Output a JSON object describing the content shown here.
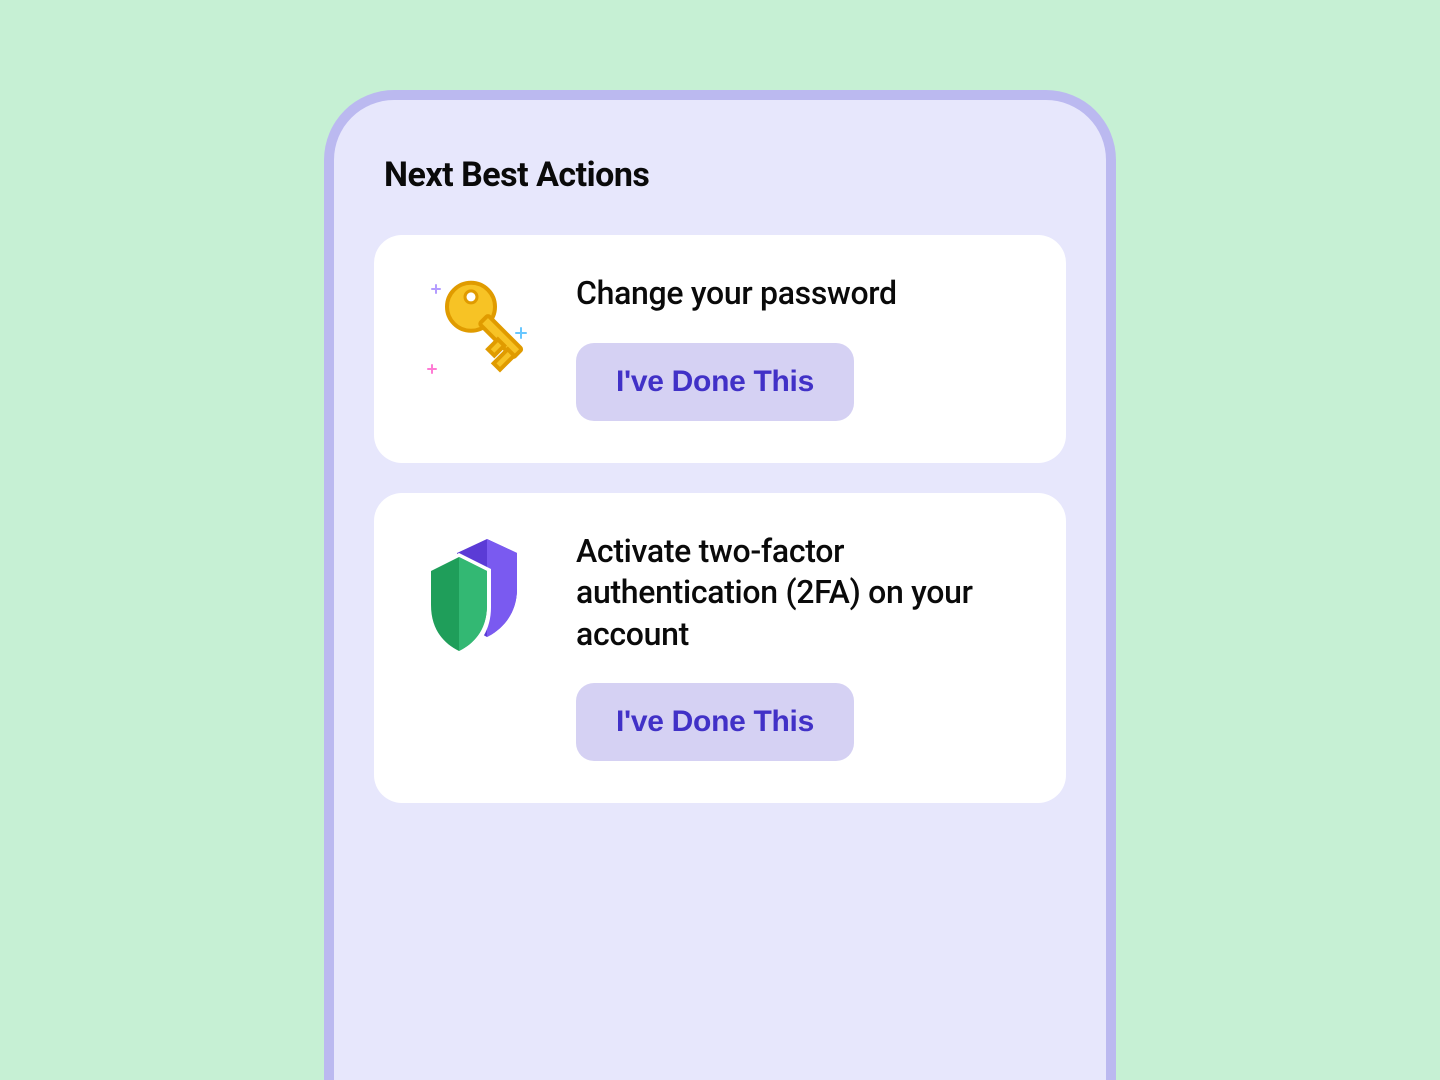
{
  "section": {
    "title": "Next Best Actions"
  },
  "actions": [
    {
      "icon": "key-icon",
      "title": "Change your password",
      "button_label": "I've Done This"
    },
    {
      "icon": "shield-icon",
      "title": "Activate two-factor authentication (2FA) on your account",
      "button_label": "I've Done This"
    }
  ],
  "colors": {
    "page_bg": "#c6f0d4",
    "panel_bg": "#e7e7fc",
    "panel_border": "#bbb9f0",
    "card_bg": "#ffffff",
    "button_bg": "#d5d1f3",
    "button_text": "#4131c7",
    "text": "#0a0a0a"
  }
}
